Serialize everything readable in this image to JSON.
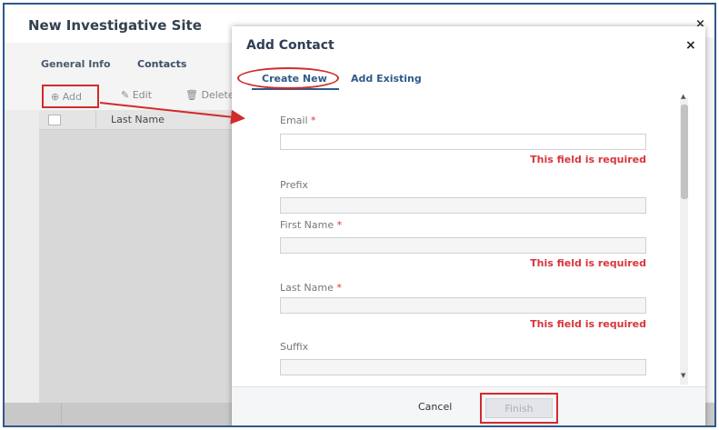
{
  "background": {
    "title": "New Investigative Site",
    "close": "×",
    "tabs": [
      "General Info",
      "Contacts"
    ],
    "toolbar": {
      "add": "Add",
      "edit": "Edit",
      "delete": "Delete"
    },
    "grid": {
      "column": "Last Name"
    }
  },
  "modal": {
    "title": "Add Contact",
    "close": "×",
    "tabs": [
      "Create New",
      "Add Existing"
    ],
    "fields": [
      {
        "label": "Email",
        "required": true,
        "error": "This field is required"
      },
      {
        "label": "Prefix",
        "required": false,
        "error": ""
      },
      {
        "label": "First Name",
        "required": true,
        "error": "This field is required"
      },
      {
        "label": "Last Name",
        "required": true,
        "error": "This field is required"
      },
      {
        "label": "Suffix",
        "required": false,
        "error": ""
      }
    ],
    "required_mark": "*",
    "footer": {
      "cancel": "Cancel",
      "finish": "Finish"
    }
  },
  "colors": {
    "accent": "#2f5a8a",
    "error": "#d8353b",
    "highlight": "#d12b2b"
  }
}
